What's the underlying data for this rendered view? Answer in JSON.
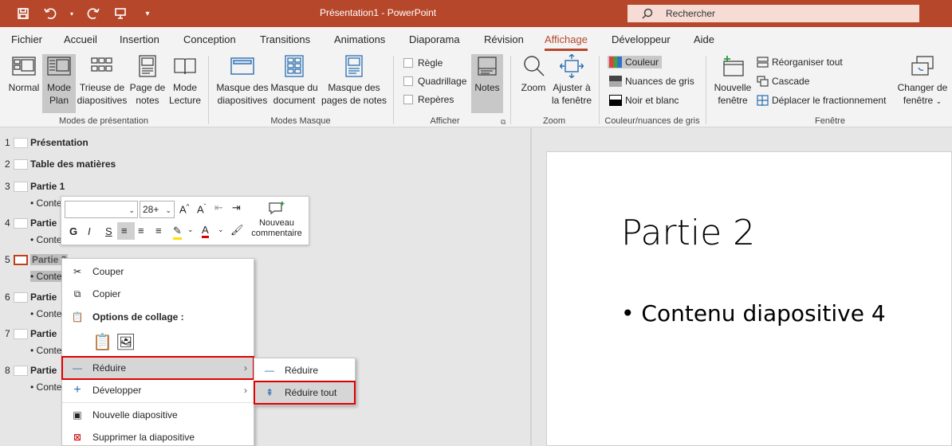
{
  "window": {
    "title": "Présentation1  -  PowerPoint"
  },
  "search": {
    "placeholder": "Rechercher"
  },
  "tabs": [
    "Fichier",
    "Accueil",
    "Insertion",
    "Conception",
    "Transitions",
    "Animations",
    "Diaporama",
    "Révision",
    "Affichage",
    "Développeur",
    "Aide"
  ],
  "ribbon": {
    "views": {
      "normal": "Normal",
      "plan": "Mode Plan",
      "trieuse": "Trieuse de diapositives",
      "page_notes": "Page de notes",
      "lecture": "Mode Lecture",
      "group": "Modes de présentation"
    },
    "masters": {
      "diapos": "Masque des diapositives",
      "document": "Masque du document",
      "notes": "Masque des pages de notes",
      "group": "Modes Masque"
    },
    "show": {
      "regle": "Règle",
      "quadrillage": "Quadrillage",
      "reperes": "Repères",
      "notes": "Notes",
      "group": "Afficher"
    },
    "zoom": {
      "zoom": "Zoom",
      "ajuster": "Ajuster à la fenêtre",
      "group": "Zoom"
    },
    "color": {
      "couleur": "Couleur",
      "gris": "Nuances de gris",
      "noir_blanc": "Noir et blanc",
      "group": "Couleur/nuances de gris"
    },
    "window": {
      "nouvelle": "Nouvelle fenêtre",
      "reorganiser": "Réorganiser tout",
      "cascade": "Cascade",
      "deplacer": "Déplacer le fractionnement",
      "changer": "Changer de fenêtre",
      "group": "Fenêtre"
    }
  },
  "outline": [
    {
      "num": "1",
      "title": "Présentation",
      "bullet": ""
    },
    {
      "num": "2",
      "title": "Table des matières",
      "bullet": ""
    },
    {
      "num": "3",
      "title": "Partie 1",
      "bullet": "• Conte"
    },
    {
      "num": "4",
      "title": "Partie",
      "bullet": "• Conte"
    },
    {
      "num": "5",
      "title": "Partie 2",
      "bullet": "• Conte"
    },
    {
      "num": "6",
      "title": "Partie",
      "bullet": "• Conte"
    },
    {
      "num": "7",
      "title": "Partie",
      "bullet": "• Conte"
    },
    {
      "num": "8",
      "title": "Partie",
      "bullet": "• Conte"
    }
  ],
  "mini_toolbar": {
    "font_size": "28+",
    "bold": "G",
    "italic": "I",
    "shadow": "S",
    "comment": "Nouveau commentaire"
  },
  "context_menu": {
    "couper": "Couper",
    "copier": "Copier",
    "options_collage": "Options de collage :",
    "reduire": "Réduire",
    "developper": "Développer",
    "nouvelle_diapo": "Nouvelle diapositive",
    "supprimer_diapo": "Supprimer la diapositive"
  },
  "submenu": {
    "reduire": "Réduire",
    "reduire_tout": "Réduire tout"
  },
  "slide": {
    "title": "Partie 2",
    "bullet": "• Contenu diapositive 4"
  }
}
